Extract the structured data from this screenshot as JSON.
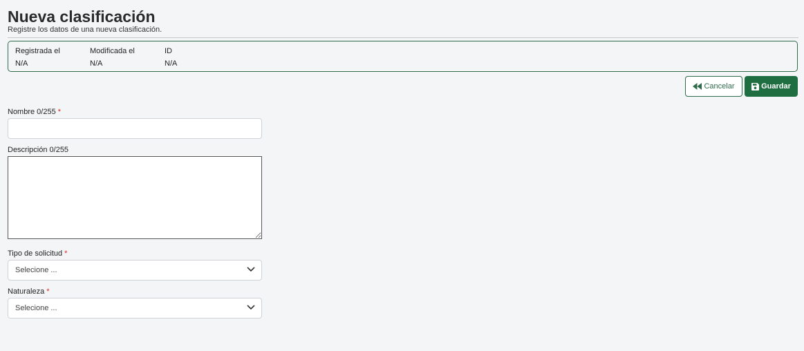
{
  "page": {
    "title": "Nueva clasificación",
    "subtitle": "Registre los datos de una nueva clasificación."
  },
  "info": {
    "registered_label": "Registrada el",
    "registered_value": "N/A",
    "modified_label": "Modificada el",
    "modified_value": "N/A",
    "id_label": "ID",
    "id_value": "N/A"
  },
  "actions": {
    "cancel_label": "Cancelar",
    "save_label": "Guardar"
  },
  "form": {
    "name_label": "Nombre 0/255",
    "name_value": "",
    "description_label": "Descripción 0/255",
    "description_value": "",
    "request_type_label": "Tipo de solicitud",
    "request_type_selected": "Selecione ...",
    "nature_label": "Naturaleza",
    "nature_selected": "Selecione ...",
    "required_mark": "*"
  },
  "colors": {
    "primary": "#1f6e42",
    "border_accent": "#2e6b4a",
    "required": "#d62828"
  }
}
